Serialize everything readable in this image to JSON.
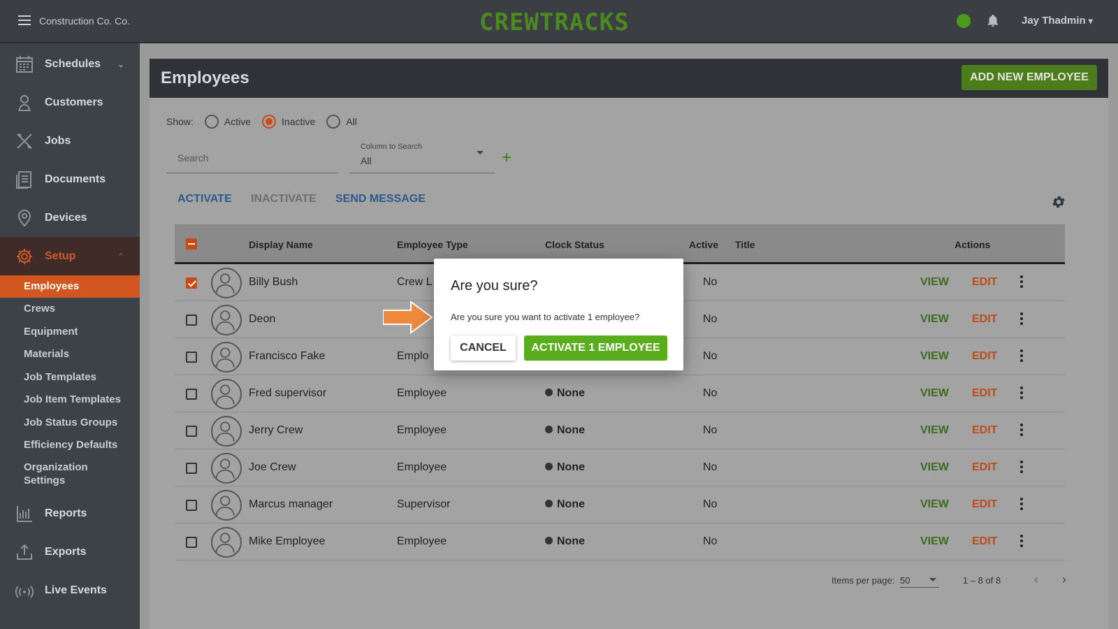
{
  "header": {
    "company": "Construction Co. Co.",
    "logo": "CREWTRACKS",
    "user": "Jay Thadmin",
    "status_color": "#4a9a1c"
  },
  "sidebar": {
    "items": [
      {
        "label": "Schedules",
        "icon": "calendar-icon"
      },
      {
        "label": "Customers",
        "icon": "customer-icon"
      },
      {
        "label": "Jobs",
        "icon": "tools-icon"
      },
      {
        "label": "Documents",
        "icon": "documents-icon"
      },
      {
        "label": "Devices",
        "icon": "location-pin-icon"
      },
      {
        "label": "Setup",
        "icon": "gear-icon"
      }
    ],
    "setup_items": [
      "Employees",
      "Crews",
      "Equipment",
      "Materials",
      "Job Templates",
      "Job Item Templates",
      "Job Status Groups",
      "Efficiency Defaults",
      "Organization Settings"
    ],
    "bottom_items": [
      {
        "label": "Reports",
        "icon": "chart-icon"
      },
      {
        "label": "Exports",
        "icon": "upload-icon"
      },
      {
        "label": "Live Events",
        "icon": "broadcast-icon"
      }
    ]
  },
  "page": {
    "title": "Employees",
    "add_button": "ADD NEW EMPLOYEE",
    "show_label": "Show:",
    "show_options": [
      "Active",
      "Inactive",
      "All"
    ],
    "show_selected": "Inactive",
    "search_placeholder": "Search",
    "column_search_label": "Column to Search",
    "column_search_value": "All",
    "actions": [
      "ACTIVATE",
      "INACTIVATE",
      "SEND MESSAGE"
    ]
  },
  "table": {
    "columns": [
      "Display Name",
      "Employee Type",
      "Clock Status",
      "Active",
      "Title",
      "Actions"
    ],
    "view_label": "VIEW",
    "edit_label": "EDIT",
    "rows": [
      {
        "name": "Billy Bush",
        "type": "Crew L",
        "clock": "",
        "active": "No",
        "checked": true
      },
      {
        "name": "Deon",
        "type": "",
        "clock": "",
        "active": "No",
        "checked": false
      },
      {
        "name": "Francisco Fake",
        "type": "Emplo",
        "clock": "",
        "active": "No",
        "checked": false
      },
      {
        "name": "Fred supervisor",
        "type": "Employee",
        "clock": "None",
        "active": "No",
        "checked": false
      },
      {
        "name": "Jerry Crew",
        "type": "Employee",
        "clock": "None",
        "active": "No",
        "checked": false
      },
      {
        "name": "Joe Crew",
        "type": "Employee",
        "clock": "None",
        "active": "No",
        "checked": false
      },
      {
        "name": "Marcus manager",
        "type": "Supervisor",
        "clock": "None",
        "active": "No",
        "checked": false
      },
      {
        "name": "Mike Employee",
        "type": "Employee",
        "clock": "None",
        "active": "No",
        "checked": false
      }
    ]
  },
  "pager": {
    "items_label": "Items per page:",
    "per_page": "50",
    "range": "1 – 8 of 8"
  },
  "modal": {
    "title": "Are you sure?",
    "body": "Are you sure you want to activate 1 employee?",
    "cancel": "CANCEL",
    "confirm": "ACTIVATE 1 EMPLOYEE"
  }
}
